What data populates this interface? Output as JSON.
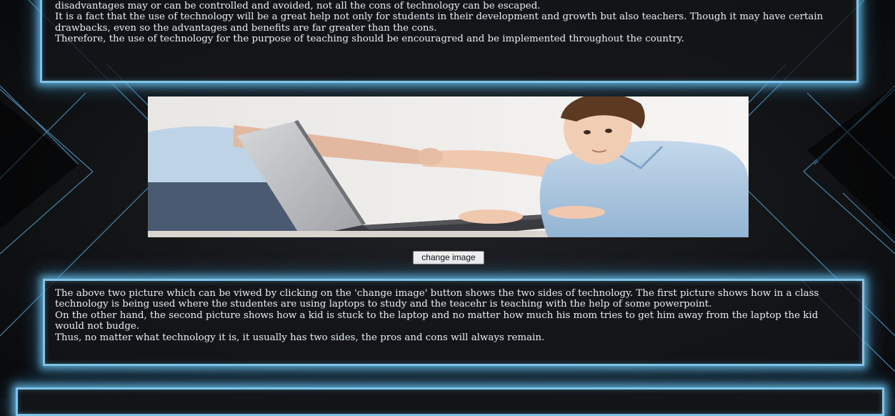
{
  "article_top": {
    "lines": [
      "disadvantages may or can be controlled and avoided, not all the cons of technology can be escaped.",
      "It is a fact that the use of technology will be a great help not only for students in their development and growth but also teachers. Though it may have certain",
      "drawbacks, even so the advantages and benefits are far greater than the cons.",
      "Therefore, the use of technology for the purpose of teaching should be encouragred and be implemented throughout the country."
    ]
  },
  "slideshow": {
    "button_label": "change image",
    "image_alt": "A child at a laptop while an adult pulls his arm",
    "colors": {
      "shirt": "#a9c6df",
      "laptop": "#2b2b2e",
      "background": "#f3f1ee"
    }
  },
  "article_mid": {
    "lines": [
      "The above two picture which can be viwed by clicking on the 'change image' button shows the two sides of technology. The first picture shows how in a class",
      "technology is being used where the studentes are using laptops to study and the teacehr is teaching with the help of some powerpoint.",
      "On the other hand, the second picture shows how a kid is stuck to the laptop and no matter how much his mom tries to get him away from the laptop the kid",
      "would not budge.",
      "Thus, no matter what technology it is, it usually has two sides, the pros and cons will always remain."
    ]
  },
  "theme": {
    "glow": "#7fc4e6",
    "background": "#0d0e10",
    "text": "#e8eef6"
  }
}
